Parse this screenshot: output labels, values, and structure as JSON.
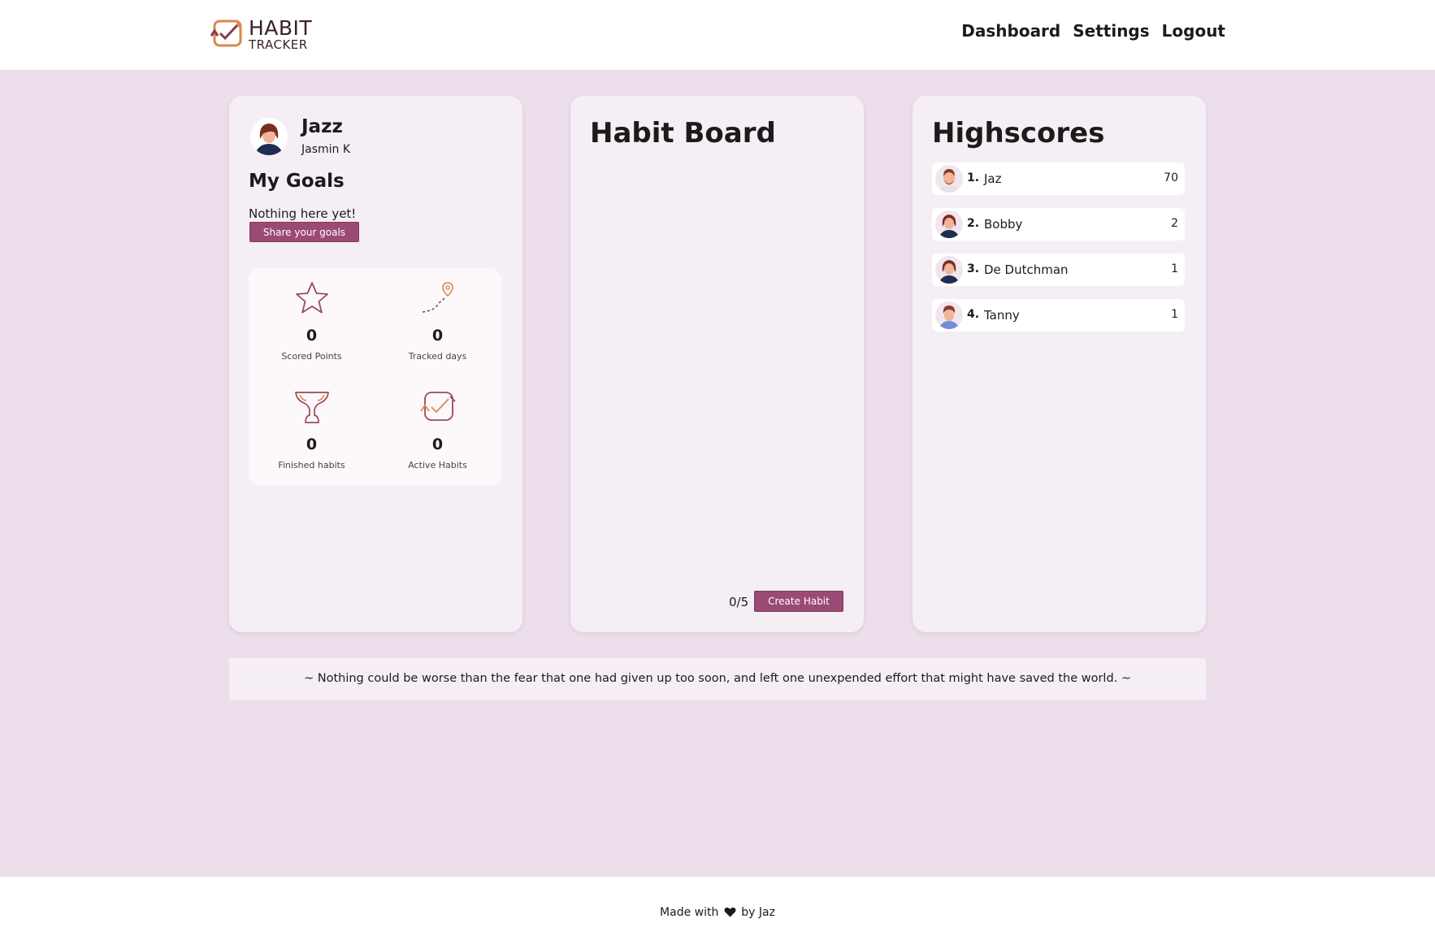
{
  "header": {
    "logo": {
      "line1": "HABIT",
      "line2": "TRACKER"
    },
    "nav": [
      "Dashboard",
      "Settings",
      "Logout"
    ]
  },
  "profile": {
    "display_name": "Jazz",
    "full_name": "Jasmin K",
    "goals_title": "My Goals",
    "goals_empty": "Nothing here yet!",
    "share_button": "Share your goals",
    "stats": [
      {
        "icon": "star-icon",
        "value": "0",
        "label": "Scored Points"
      },
      {
        "icon": "route-pin-icon",
        "value": "0",
        "label": "Tracked days"
      },
      {
        "icon": "trophy-icon",
        "value": "0",
        "label": "Finished habits"
      },
      {
        "icon": "habit-check-icon",
        "value": "0",
        "label": "Active Habits"
      }
    ]
  },
  "board": {
    "title": "Habit Board",
    "count": "0/5",
    "create_button": "Create Habit"
  },
  "highscores": {
    "title": "Highscores",
    "entries": [
      {
        "rank": "1.",
        "name": "Jaz",
        "points": "70"
      },
      {
        "rank": "2.",
        "name": "Bobby",
        "points": "2"
      },
      {
        "rank": "3.",
        "name": "De Dutchman",
        "points": "1"
      },
      {
        "rank": "4.",
        "name": "Tanny",
        "points": "1"
      }
    ]
  },
  "quote": "~ Nothing could be worse than the fear that one had given up too soon, and left one unexpended effort that might have saved the world. ~",
  "footer": {
    "before": "Made with",
    "after": "by Jaz"
  },
  "colors": {
    "background": "#ecdeeb",
    "card": "#f6eef5",
    "button": "#9b4a74",
    "icon_accent": "#d98a4a",
    "icon_dark": "#8a3a4a"
  }
}
